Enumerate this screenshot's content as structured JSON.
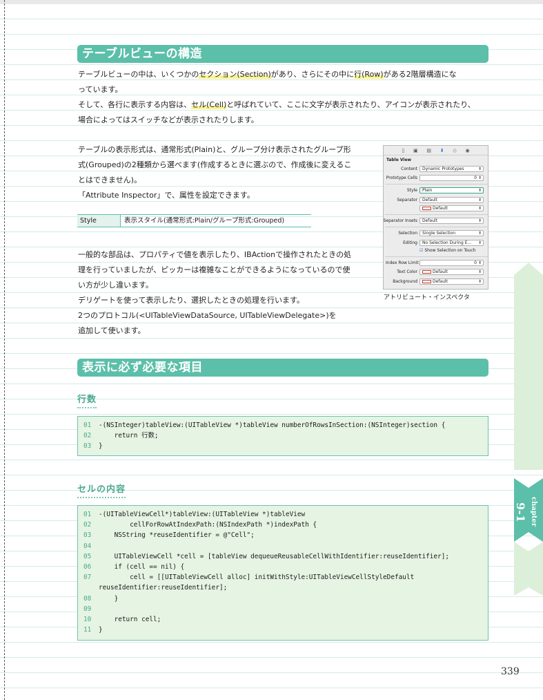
{
  "section1": {
    "title": "テーブルビューの構造",
    "p1": {
      "a": "テーブルビューの中は、いくつかの",
      "hl1": "セクション(Section)",
      "b": "があり、さらにその中に",
      "hl2": "行(Row)",
      "c": "がある2階層構造にな",
      "line2": "っています。"
    },
    "p2": {
      "a": "そして、各行に表示する内容は、",
      "hl": "セル(Cell)",
      "b": "と呼ばれていて、ここに文字が表示されたり、アイコンが表示されたり、",
      "line2": "場合によってはスイッチなどが表示されたりします。"
    },
    "p3": {
      "l1": "テーブルの表示形式は、通常形式(Plain)と、グループ分け表示されたグループ形",
      "l2": "式(Grouped)の2種類から選べます(作成するときに選ぶので、作成後に変えるこ",
      "l3": "とはできません)。",
      "l4": "「Attribute Inspector」で、属性を設定できます。"
    },
    "table": {
      "key": "Style",
      "value": "表示スタイル(通常形式:Plain/グループ形式:Grouped)"
    },
    "p4": {
      "l1": "一般的な部品は、プロパティで値を表示したり、IBActionで操作されたときの処",
      "l2": "理を行っていましたが、ピッカーは複雑なことができるようになっているので使",
      "l3": "い方が少し違います。",
      "l4": "デリゲートを使って表示したり、選択したときの処理を行います。",
      "l5": "2つのプロトコル(<UITableViewDataSource, UITableViewDelegate>)を",
      "l6": "追加して使います。"
    }
  },
  "inspector": {
    "toolbar_icons": [
      "file-icon",
      "help-icon",
      "identity-icon",
      "attributes-icon",
      "size-icon",
      "connections-icon"
    ],
    "title": "Table View",
    "rows": {
      "content": {
        "label": "Content",
        "value": "Dynamic Prototypes"
      },
      "prototype_cells": {
        "label": "Prototype Cells",
        "value": "0"
      },
      "style": {
        "label": "Style",
        "value": "Plain"
      },
      "separator": {
        "label": "Separator",
        "value": "Default"
      },
      "separator_color": {
        "value": "Default"
      },
      "separator_insets": {
        "label": "Separator Insets",
        "value": "Default"
      },
      "selection": {
        "label": "Selection",
        "value": "Single Selection"
      },
      "editing": {
        "label": "Editing",
        "value": "No Selection During E..."
      },
      "show_selection": {
        "label": "Show Selection on Touch",
        "checked": true
      },
      "index_row_limit": {
        "label": "Index Row Limit",
        "value": "0"
      },
      "text_color": {
        "label": "Text Color",
        "value": "Default"
      },
      "background": {
        "label": "Background",
        "value": "Default"
      }
    },
    "caption": "アトリビュート・インスペクタ"
  },
  "section2": {
    "title": "表示に必ず必要な項目",
    "sub1": "行数",
    "code1": [
      {
        "n": "01",
        "t": "-(NSInteger)tableView:(UITableView *)tableView numberOfRowsInSection:(NSInteger)section {"
      },
      {
        "n": "02",
        "t": "    return 行数;"
      },
      {
        "n": "03",
        "t": "}"
      }
    ],
    "sub2": "セルの内容",
    "code2": [
      {
        "n": "01",
        "t": "-(UITableViewCell*)tableView:(UITableView *)tableView"
      },
      {
        "n": "02",
        "t": "        cellForRowAtIndexPath:(NSIndexPath *)indexPath {"
      },
      {
        "n": "03",
        "t": "    NSString *reuseIdentifier = @\"Cell\";"
      },
      {
        "n": "04",
        "t": ""
      },
      {
        "n": "05",
        "t": "    UITableViewCell *cell = [tableView dequeueReusableCellWithIdentifier:reuseIdentifier];"
      },
      {
        "n": "06",
        "t": "    if (cell == nil) {"
      },
      {
        "n": "07",
        "t": "        cell = [[UITableViewCell alloc] initWithStyle:UITableViewCellStyleDefault"
      },
      {
        "n": "",
        "t": "reuseIdentifier:reuseIdentifier];"
      },
      {
        "n": "08",
        "t": "    }"
      },
      {
        "n": "09",
        "t": ""
      },
      {
        "n": "10",
        "t": "    return cell;"
      },
      {
        "n": "11",
        "t": "}"
      }
    ]
  },
  "chapter": {
    "label": "chapter",
    "number": "9-1"
  },
  "page_number": "339",
  "colors": {
    "accent": "#5bbfa9",
    "code_bg": "#e6f4e3",
    "highlight": "#fbf38a",
    "tab_light": "#dcefd9"
  }
}
